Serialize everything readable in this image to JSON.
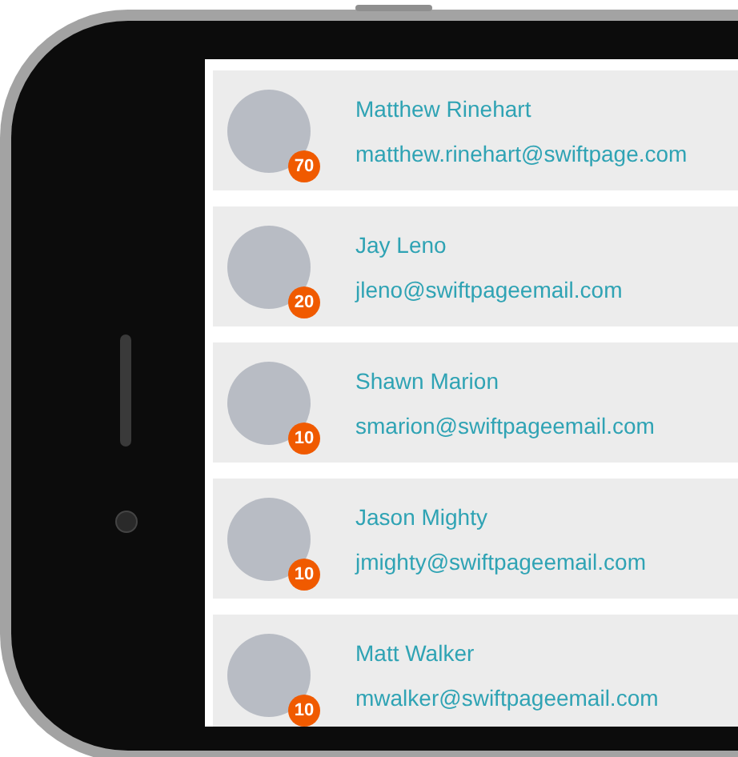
{
  "contacts": [
    {
      "name": "Matthew Rinehart",
      "email": "matthew.rinehart@swiftpage.com",
      "badge": "70"
    },
    {
      "name": "Jay Leno",
      "email": "jleno@swiftpageemail.com",
      "badge": "20"
    },
    {
      "name": "Shawn Marion",
      "email": "smarion@swiftpageemail.com",
      "badge": "10"
    },
    {
      "name": "Jason Mighty",
      "email": "jmighty@swiftpageemail.com",
      "badge": "10"
    },
    {
      "name": "Matt Walker",
      "email": "mwalker@swiftpageemail.com",
      "badge": "10"
    }
  ]
}
